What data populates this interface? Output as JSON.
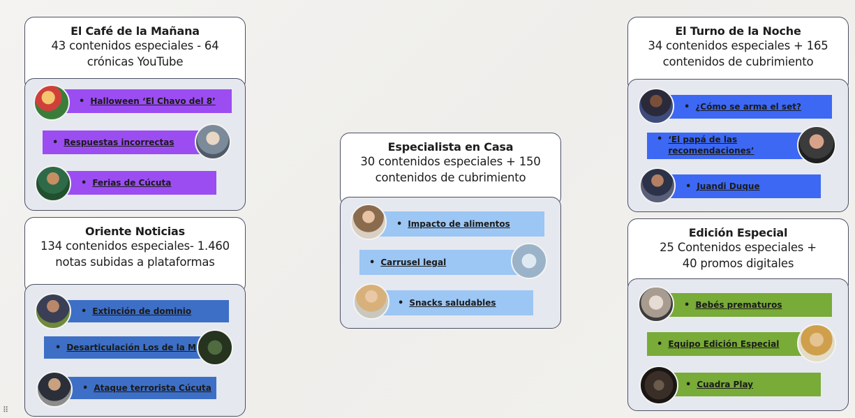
{
  "cards": {
    "cafe": {
      "title": "El Café de la Mañana",
      "line1": "43 contenidos especiales - 64",
      "line2": "crónicas YouTube",
      "items": [
        "Halloween ‘El Chavo del 8’",
        "Respuestas incorrectas",
        "Ferias de Cúcuta"
      ]
    },
    "oriente": {
      "title": "Oriente Noticias",
      "line1": "134 contenidos especiales- 1.460",
      "line2": "notas subidas a plataformas",
      "items": [
        "Extinción de dominio",
        "Desarticulación Los de la M",
        "Ataque terrorista Cúcuta"
      ]
    },
    "especialista": {
      "title": "Especialista en Casa",
      "line1": "30 contenidos especiales + 150",
      "line2": "contenidos de cubrimiento",
      "items": [
        "Impacto de alimentos",
        "Carrusel legal",
        "Snacks saludables"
      ]
    },
    "turno": {
      "title": "El Turno de la Noche",
      "line1": "34 contenidos especiales + 165",
      "line2": "contenidos de cubrimiento",
      "items": [
        "¿Cómo se arma el set?",
        "‘El papá de las",
        "recomendaciones’",
        "Juandi Duque"
      ]
    },
    "edicion": {
      "title": "Edición Especial",
      "line1": "25 Contenidos especiales +",
      "line2": "40 promos digitales",
      "items": [
        "Bebés prematuros",
        "Equipo Edición Especial",
        "Cuadra Play"
      ]
    }
  },
  "bullet": "•",
  "colors": {
    "purple": "#9b4df2",
    "blue": "#3c68f4",
    "steel": "#3d6fc6",
    "lightblue": "#9cc6f4",
    "green": "#78ab37",
    "border": "#4a4f63",
    "panel": "#e6e8ef"
  },
  "icons": [
    "person-avatar-icon",
    "resize-grip-icon"
  ]
}
